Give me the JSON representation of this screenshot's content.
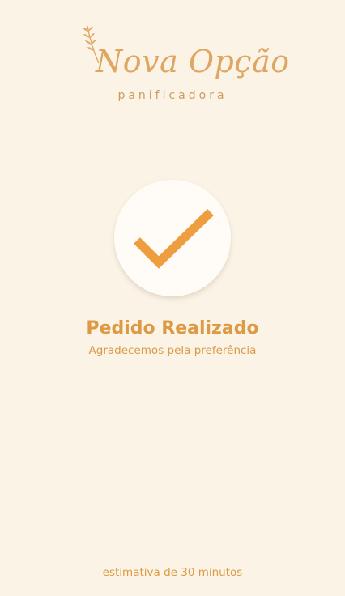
{
  "brand": {
    "name": "Nova Opção",
    "tagline": "panificadora"
  },
  "status": {
    "title": "Pedido Realizado",
    "message": "Agradecemos pela preferência"
  },
  "footer": {
    "estimate": "estimativa de 30 minutos"
  },
  "colors": {
    "background": "#faf3e6",
    "accent": "#dd9a45",
    "check": "#ee9e3f",
    "circle": "#fffcf7"
  },
  "icons": {
    "logo_ornament": "wheat-icon",
    "status": "checkmark-icon"
  }
}
